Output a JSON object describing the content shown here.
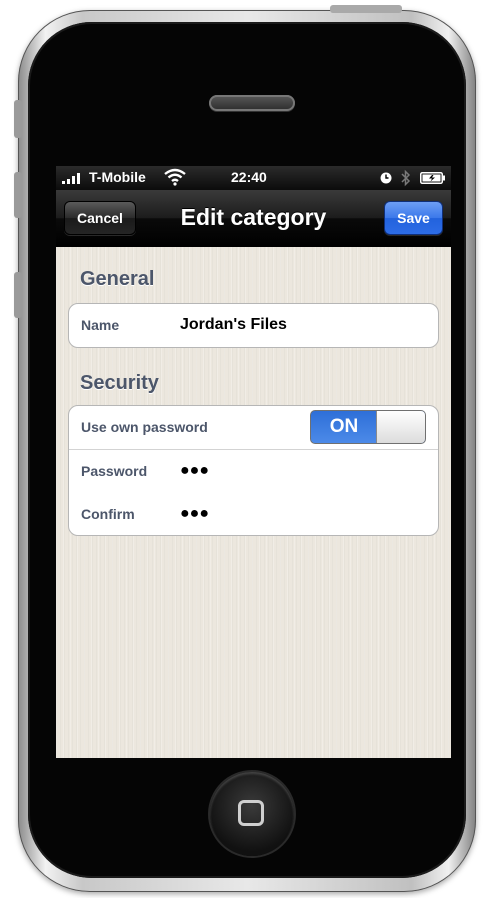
{
  "status_bar": {
    "carrier": "T-Mobile",
    "time": "22:40",
    "icons": [
      "signal-icon",
      "wifi-icon",
      "alarm-icon",
      "bluetooth-icon",
      "battery-icon"
    ]
  },
  "nav": {
    "title": "Edit category",
    "cancel_label": "Cancel",
    "save_label": "Save"
  },
  "sections": {
    "general": {
      "header": "General",
      "name_label": "Name",
      "name_value": "Jordan's Files"
    },
    "security": {
      "header": "Security",
      "own_password_label": "Use own password",
      "own_password_toggle": "ON",
      "password_label": "Password",
      "password_value": "●●●",
      "confirm_label": "Confirm",
      "confirm_value": "●●●"
    }
  },
  "colors": {
    "save_button": "#3b78ea",
    "toggle_on": "#2e6fd8",
    "section_header": "#4c566a",
    "background": "#ece7de"
  }
}
